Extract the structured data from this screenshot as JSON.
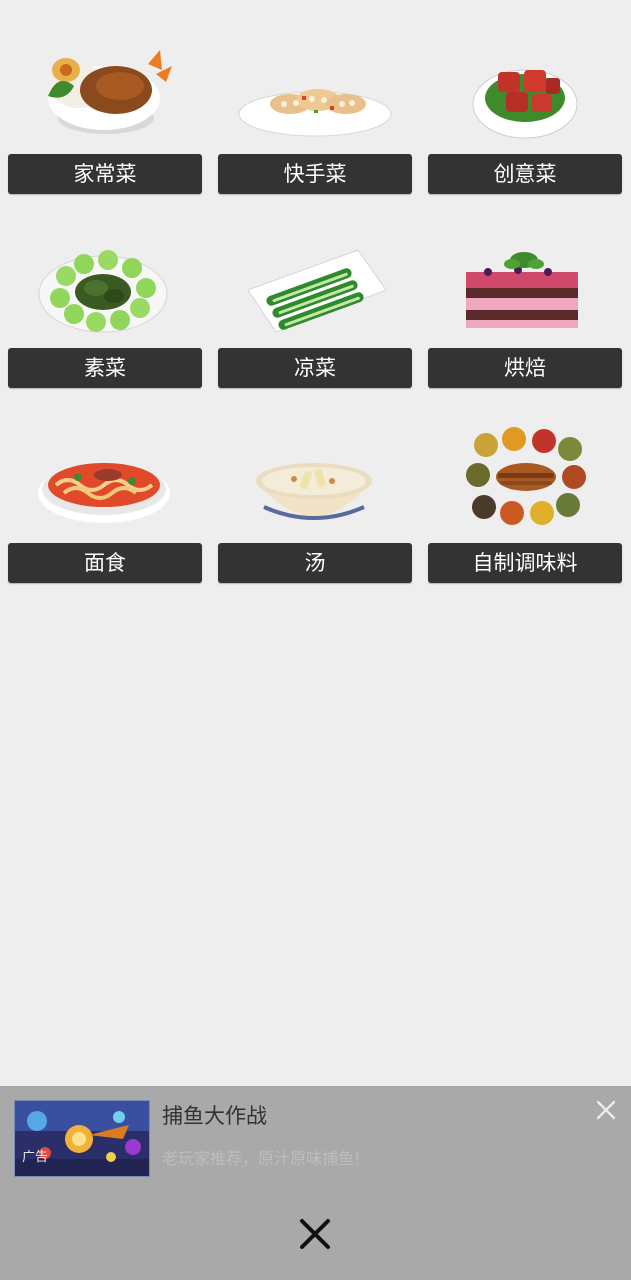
{
  "categories": [
    {
      "label": "家常菜",
      "icon": "braised-pork-rice-icon"
    },
    {
      "label": "快手菜",
      "icon": "lotus-root-plate-icon"
    },
    {
      "label": "创意菜",
      "icon": "red-braised-pork-icon"
    },
    {
      "label": "素菜",
      "icon": "green-vegetable-plate-icon"
    },
    {
      "label": "凉菜",
      "icon": "cucumber-plate-icon"
    },
    {
      "label": "烘焙",
      "icon": "layer-cake-icon"
    },
    {
      "label": "面食",
      "icon": "noodle-bowl-icon"
    },
    {
      "label": "汤",
      "icon": "soup-bowl-icon"
    },
    {
      "label": "自制调味料",
      "icon": "spice-assortment-icon"
    }
  ],
  "ad": {
    "tag": "广告",
    "title": "捕鱼大作战",
    "description": "老玩家推荐，原汁原味捕鱼!",
    "close_small_icon": "close-icon",
    "close_big_icon": "close-icon"
  },
  "colors": {
    "background": "#eeeeee",
    "button": "#333333",
    "button_text": "#ffffff",
    "ad_background": "#a9a9a9"
  }
}
